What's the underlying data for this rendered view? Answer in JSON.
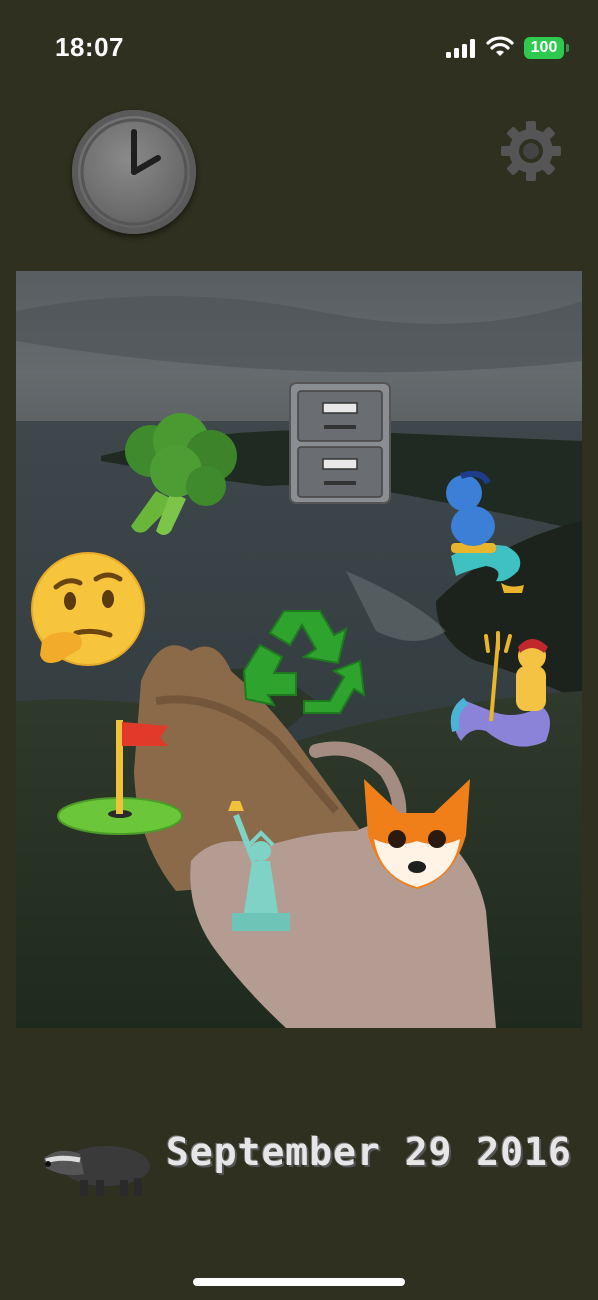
{
  "status_bar": {
    "time": "18:07",
    "battery": "100",
    "icons": [
      "cellular-signal-icon",
      "wifi-icon",
      "battery-icon"
    ]
  },
  "toolbar": {
    "left_icon": "clock-icon",
    "right_icon": "gear-icon"
  },
  "photo": {
    "description_icon_names": [
      "broccoli",
      "file-cabinet",
      "genie",
      "thinking-face",
      "recycling-symbol",
      "merperson",
      "flag-in-hole",
      "statue-of-liberty",
      "fox-face"
    ]
  },
  "footer": {
    "icon": "badger-icon",
    "date": "September 29 2016"
  },
  "colors": {
    "background": "#2f301f",
    "battery_green": "#30c94f"
  }
}
